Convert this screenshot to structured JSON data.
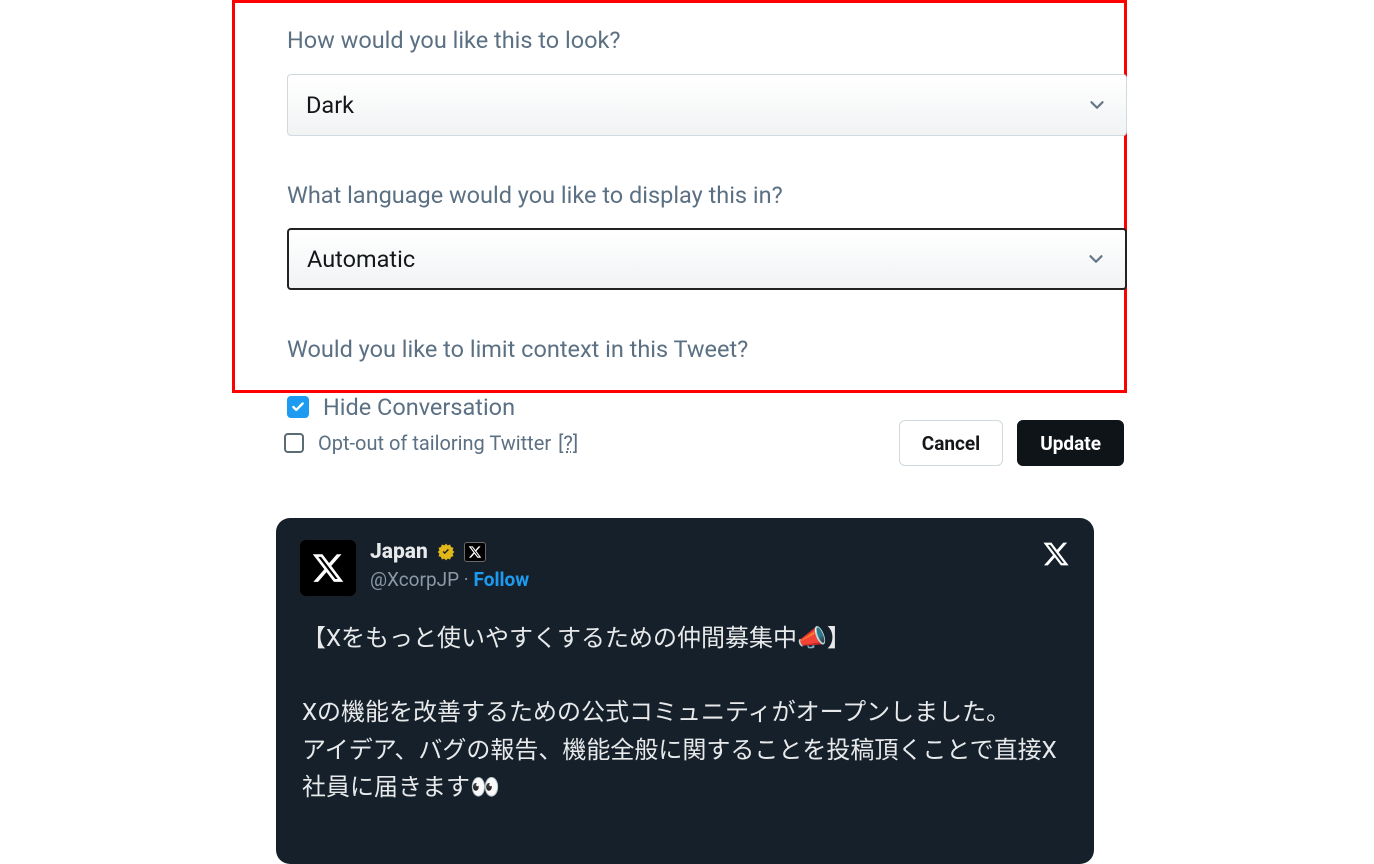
{
  "form": {
    "appearance": {
      "label": "How would you like this to look?",
      "selected": "Dark"
    },
    "language": {
      "label": "What language would you like to display this in?",
      "selected": "Automatic"
    },
    "context": {
      "label": "Would you like to limit context in this Tweet?",
      "hide_conversation_label": "Hide Conversation"
    }
  },
  "optout": {
    "text": "Opt-out of tailoring Twitter",
    "help": "[?]"
  },
  "actions": {
    "cancel": "Cancel",
    "update": "Update"
  },
  "tweet": {
    "name": "Japan",
    "handle": "@XcorpJP",
    "separator": " · ",
    "follow": "Follow",
    "body_line1": "【Xをもっと使いやすくするための仲間募集中📣】",
    "body_line2": "Xの機能を改善するための公式コミュニティがオープンしました。",
    "body_line3": "アイデア、バグの報告、機能全般に関することを投稿頂くことで直接X社員に届きます👀"
  }
}
